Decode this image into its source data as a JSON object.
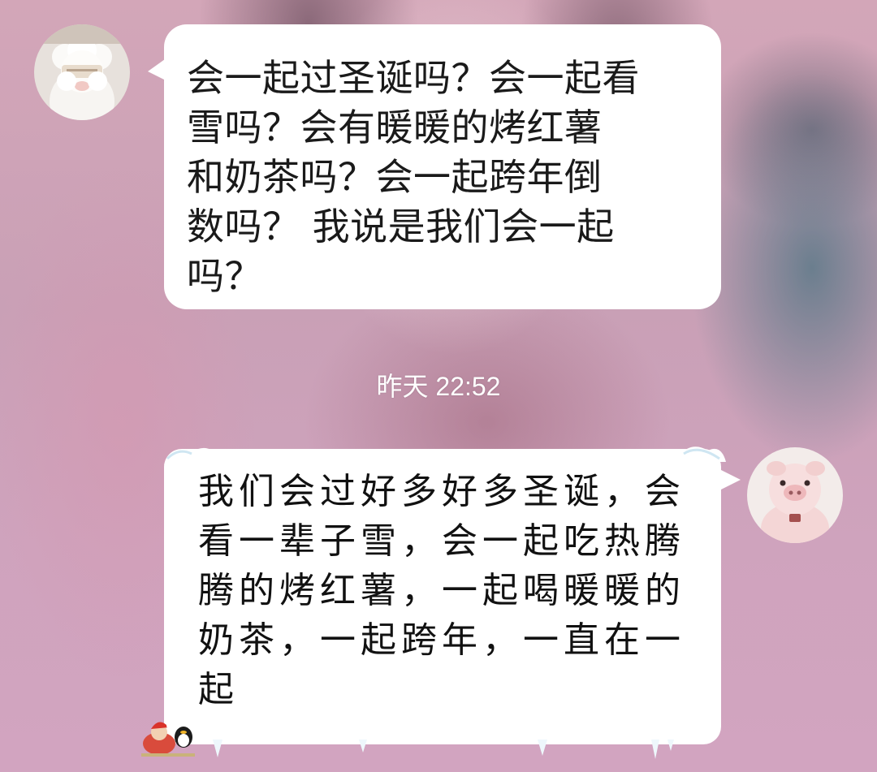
{
  "chat": {
    "incoming_message": {
      "text": "会一起过圣诞吗？会一起看\n雪吗？会有暖暖的烤红薯\n和奶茶吗？会一起跨年倒\n数吗？ 我说是我们会一起\n吗？",
      "avatar_icon": "sheep-plush-avatar-icon"
    },
    "timestamp": "昨天 22:52",
    "outgoing_message": {
      "text": "我们会过好多好多圣诞，会\n看一辈子雪，会一起吃热腾\n腾的烤红薯，一起喝暖暖的\n奶茶，一起跨年，一直在一\n起",
      "avatar_icon": "pig-plush-avatar-icon"
    }
  },
  "colors": {
    "bubble": "#ffffff",
    "timestamp_text": "#ffffff",
    "message_text": "#1a1a1a"
  }
}
